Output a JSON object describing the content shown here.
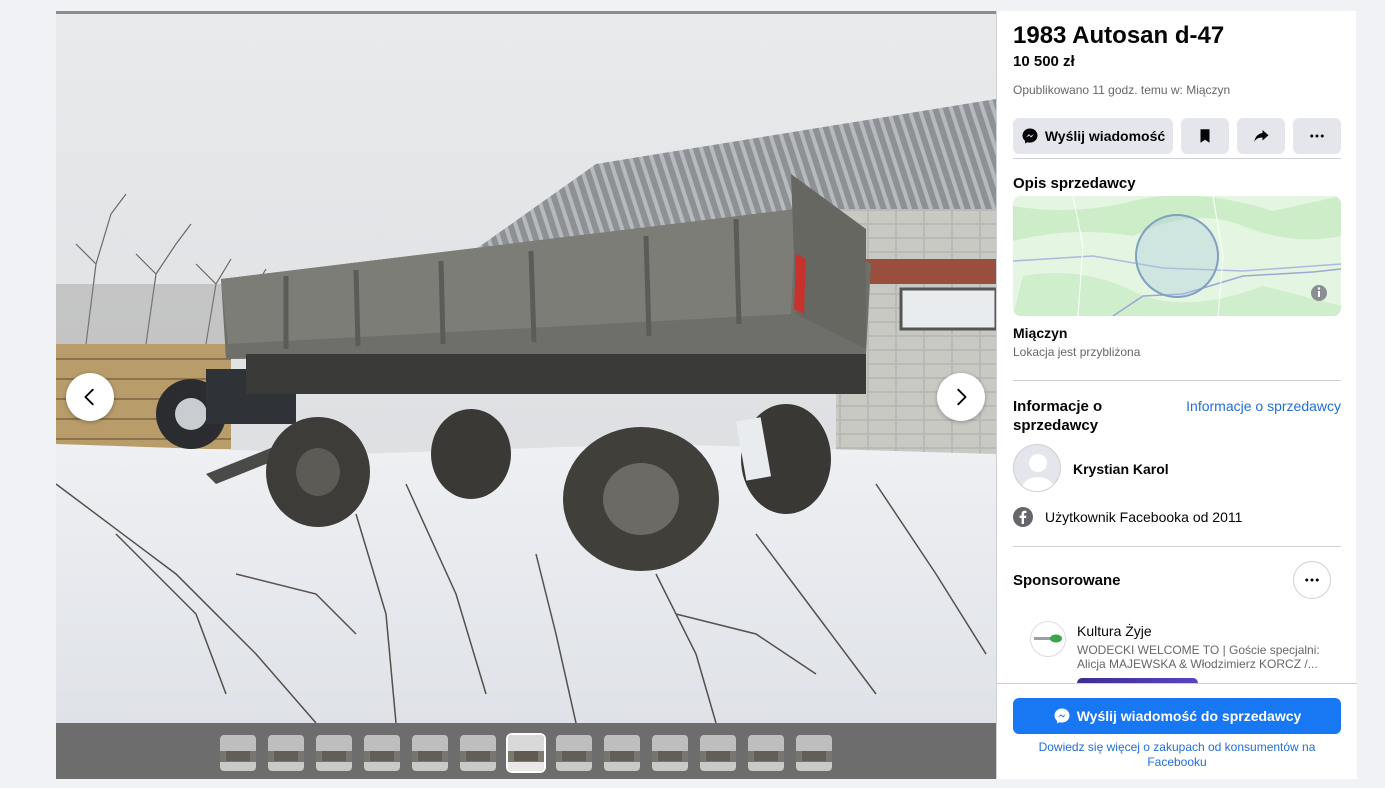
{
  "listing": {
    "title": "1983 Autosan d-47",
    "price": "10 500 zł",
    "posted": "Opublikowano 11 godz. temu w: Miączyn"
  },
  "actions": {
    "message_label": "Wyślij wiadomość"
  },
  "description": {
    "heading": "Opis sprzedawcy"
  },
  "location": {
    "name": "Miączyn",
    "note": "Lokacja jest przybliżona"
  },
  "seller": {
    "heading": "Informacje o sprzedawcy",
    "link": "Informacje o sprzedawcy",
    "name": "Krystian Karol",
    "since": "Użytkownik Facebooka od 2011"
  },
  "sponsored": {
    "heading": "Sponsorowane",
    "ad_name": "Kultura Żyje",
    "ad_text": "WODECKI WELCOME TO | Goście specjalni: Alicja MAJEWSKA & Włodzimierz KORCZ /..."
  },
  "footer": {
    "primary_label": "Wyślij wiadomość do sprzedawcy",
    "learn_more": "Dowiedz się więcej o zakupach od konsumentów na Facebooku"
  },
  "gallery": {
    "thumb_count": 13,
    "active_index": 6
  },
  "colors": {
    "accent": "#1877f2",
    "link": "#216fdb",
    "muted": "#65676b",
    "button_bg": "#e4e6eb"
  }
}
